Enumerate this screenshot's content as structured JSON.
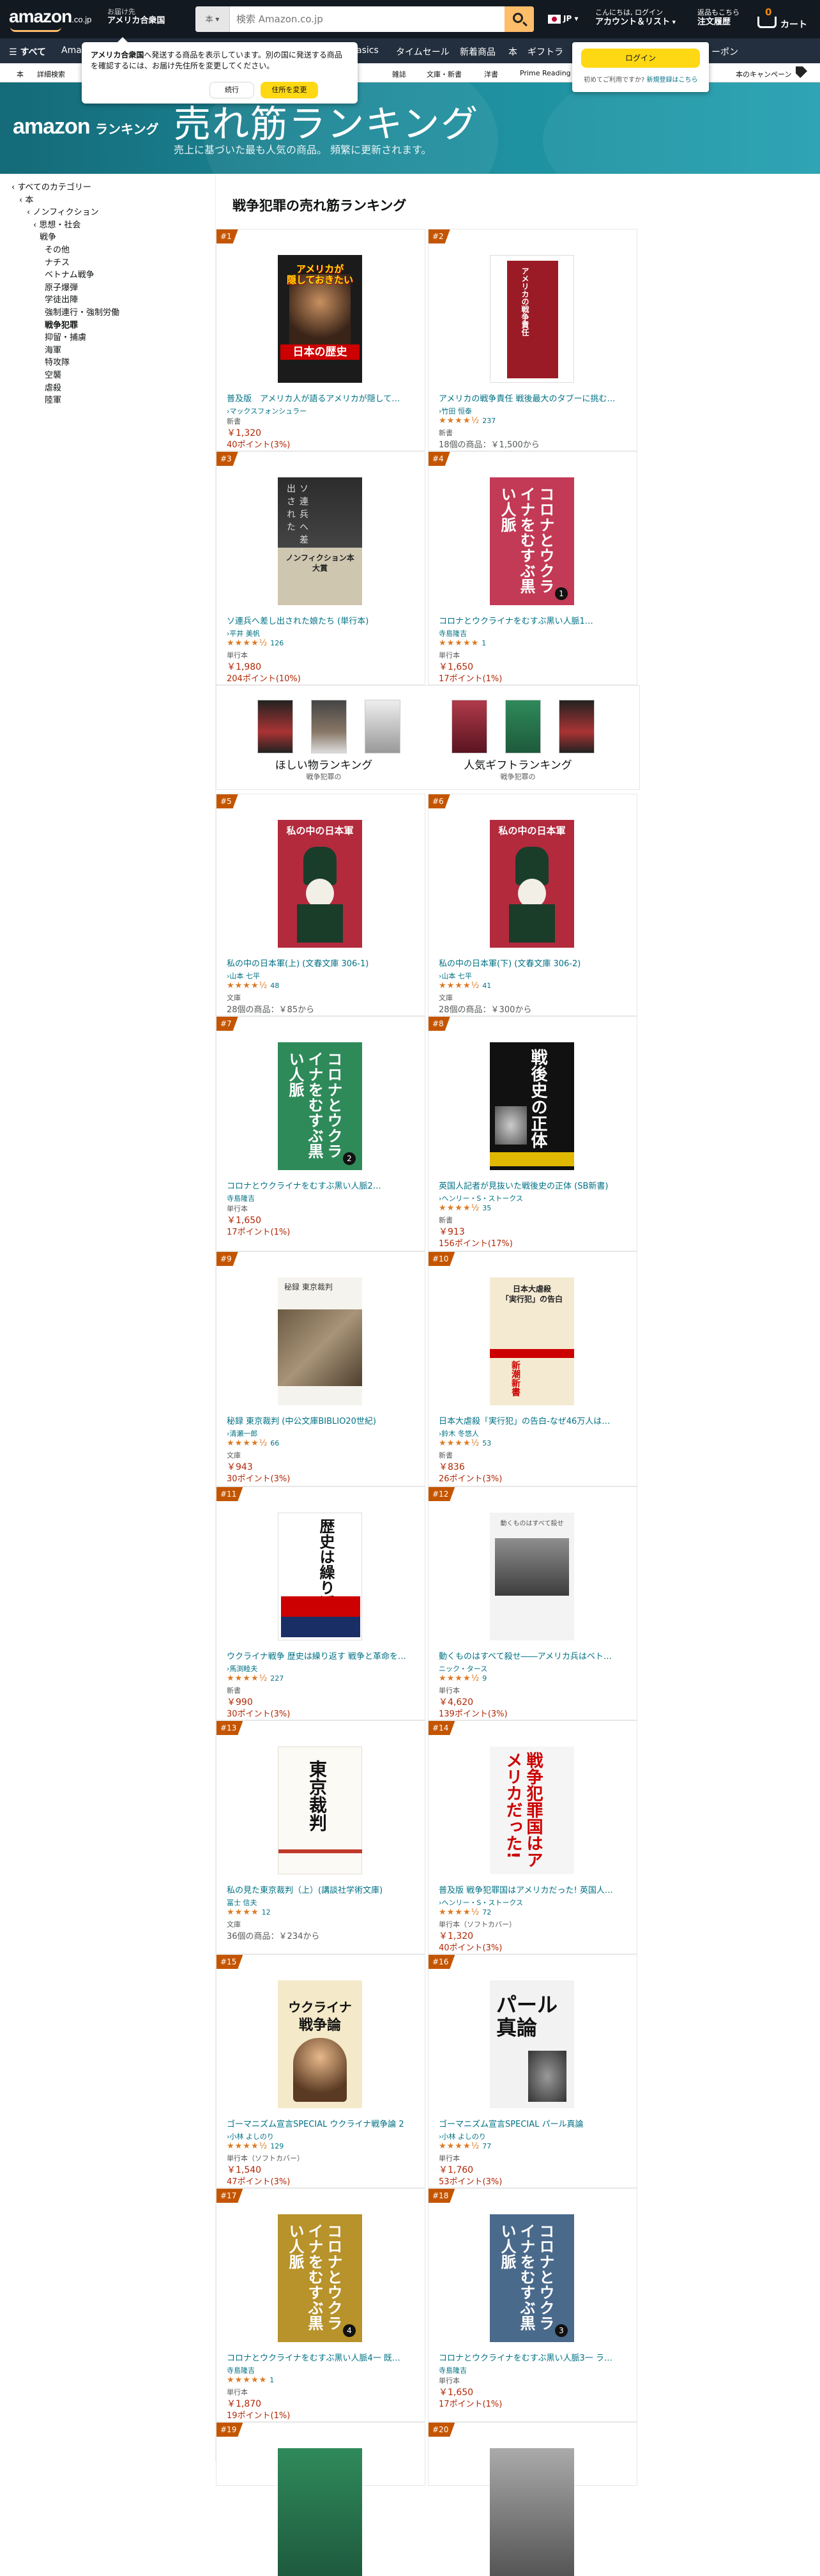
{
  "header": {
    "logo": "amazon",
    "logo_suffix": ".co.jp",
    "deliver_line1": "お届け先",
    "deliver_line2": "アメリカ合衆国",
    "search_category": "本",
    "search_placeholder": "検索 Amazon.co.jp",
    "lang": "JP",
    "account_line1": "こんにちは, ログイン",
    "account_line2": "アカウント＆リスト",
    "orders_line1": "返品もこちら",
    "orders_line2": "注文履歴",
    "cart_count": "0",
    "cart_label": "カート"
  },
  "nav": {
    "all": "すべて",
    "items": [
      "Amazon",
      "asics",
      "タイムセール",
      "新着商品",
      "本",
      "ギフトラ",
      "ーポン"
    ]
  },
  "subnav": {
    "items": [
      "本",
      "詳細検索",
      "雑誌",
      "文庫・新書",
      "洋書",
      "Prime Reading",
      "本のキャンペーン"
    ]
  },
  "popover": {
    "text_bold": "アメリカ合衆国",
    "text": "へ発送する商品を表示しています。別の国に発送する商品を確認するには、お届け先住所を変更してください。",
    "continue": "続行",
    "change": "住所を変更"
  },
  "login_popover": {
    "button": "ログイン",
    "text": "初めてご利用ですか?",
    "link": "新規登録はこちら"
  },
  "banner": {
    "logo": "amazon",
    "logo_suffix": "ランキング",
    "title": "売れ筋ランキング",
    "subtitle": "売上に基づいた最も人気の商品。 頻繁に更新されます。"
  },
  "sidebar": {
    "items": [
      {
        "label": "‹ すべてのカテゴリー",
        "level": 0
      },
      {
        "label": "‹ 本",
        "level": 1
      },
      {
        "label": "‹ ノンフィクション",
        "level": 2
      },
      {
        "label": "‹ 思想・社会",
        "level": 3
      },
      {
        "label": "戦争",
        "level": 4
      },
      {
        "label": "その他",
        "level": 5
      },
      {
        "label": "ナチス",
        "level": 5
      },
      {
        "label": "ベトナム戦争",
        "level": 5
      },
      {
        "label": "原子爆弾",
        "level": 5
      },
      {
        "label": "学徒出陣",
        "level": 5
      },
      {
        "label": "強制連行・強制労働",
        "level": 5
      },
      {
        "label": "戦争犯罪",
        "level": 5,
        "selected": true
      },
      {
        "label": "抑留・捕虜",
        "level": 5
      },
      {
        "label": "海軍",
        "level": 5
      },
      {
        "label": "特攻隊",
        "level": 5
      },
      {
        "label": "空襲",
        "level": 5
      },
      {
        "label": "虐殺",
        "level": 5
      },
      {
        "label": "陸軍",
        "level": 5
      }
    ]
  },
  "main": {
    "title": "戦争犯罪の売れ筋ランキング"
  },
  "promo": {
    "left_title": "ほしい物ランキング",
    "left_sub": "戦争犯罪の",
    "right_title": "人気ギフトランキング",
    "right_sub": "戦争犯罪の"
  },
  "products": [
    {
      "rank": "#1",
      "title": "普及版　アメリカ人が語るアメリカが隠して…",
      "author": "›マックスフォンシュラー",
      "stars": "",
      "reviews": "",
      "format": "新書",
      "price": "￥1,320",
      "points": "40ポイント(3%)",
      "offer": "",
      "cover": "c1",
      "cover_text": "日本の歴史"
    },
    {
      "rank": "#2",
      "title": "アメリカの戦争責任 戦後最大のタブーに挑む…",
      "author": "›竹田 恒泰",
      "stars": "★★★★½",
      "reviews": "237",
      "format": "新書",
      "price": "",
      "points": "",
      "offer": "18個の商品：￥1,500から",
      "cover": "c2",
      "cover_text": "アメリカの戦争責任"
    },
    {
      "rank": "#3",
      "title": "ソ連兵へ差し出された娘たち (単行本)",
      "author": "›平井 美帆",
      "stars": "★★★★½",
      "reviews": "126",
      "format": "単行本",
      "price": "￥1,980",
      "points": "204ポイント(10%)",
      "offer": "",
      "cover": "c3",
      "cover_text": "ノンフィクション本大賞"
    },
    {
      "rank": "#4",
      "title": "コロナとウクライナをむすぶ黒い人脈1…",
      "author": "寺島隆吉",
      "stars": "★★★★★",
      "reviews": "1",
      "format": "単行本",
      "price": "￥1,650",
      "points": "17ポイント(1%)",
      "offer": "",
      "cover": "c4",
      "cover_text": "コロナとウクライナをむすぶ黒い人脈"
    },
    {
      "rank": "#5",
      "title": "私の中の日本軍(上) (文春文庫 306-1)",
      "author": "›山本 七平",
      "stars": "★★★★½",
      "reviews": "48",
      "format": "文庫",
      "price": "",
      "points": "",
      "offer": "28個の商品：￥85から",
      "cover": "c5",
      "cover_text": "私の中の日本軍"
    },
    {
      "rank": "#6",
      "title": "私の中の日本軍(下) (文春文庫 306-2)",
      "author": "›山本 七平",
      "stars": "★★★★½",
      "reviews": "41",
      "format": "文庫",
      "price": "",
      "points": "",
      "offer": "28個の商品：￥300から",
      "cover": "c5",
      "cover_text": "私の中の日本軍"
    },
    {
      "rank": "#7",
      "title": "コロナとウクライナをむすぶ黒い人脈2…",
      "author": "寺島隆吉",
      "stars": "",
      "reviews": "",
      "format": "単行本",
      "price": "￥1,650",
      "points": "17ポイント(1%)",
      "offer": "",
      "cover": "c7",
      "cover_text": "コロナとウクライナをむすぶ黒い人脈"
    },
    {
      "rank": "#8",
      "title": "英国人記者が見抜いた戦後史の正体 (SB新書)",
      "author": "›ヘンリー・S・ストークス",
      "stars": "★★★★½",
      "reviews": "35",
      "format": "新書",
      "price": "￥913",
      "points": "156ポイント(17%)",
      "offer": "",
      "cover": "c8",
      "cover_text": "戦後史の正体"
    },
    {
      "rank": "#9",
      "title": "秘録 東京裁判 (中公文庫BIBLIO20世紀)",
      "author": "›清瀬一郎",
      "stars": "★★★★½",
      "reviews": "66",
      "format": "文庫",
      "price": "￥943",
      "points": "30ポイント(3%)",
      "offer": "",
      "cover": "c9",
      "cover_text": "秘録 東京裁判"
    },
    {
      "rank": "#10",
      "title": "日本大虐殺「実行犯」の告白-なぜ46万人は…",
      "author": "›鈴木 冬悠人",
      "stars": "★★★★½",
      "reviews": "53",
      "format": "新書",
      "price": "￥836",
      "points": "26ポイント(3%)",
      "offer": "",
      "cover": "c10",
      "cover_text": "日本大虐殺「実行犯」の告白"
    },
    {
      "rank": "#11",
      "title": "ウクライナ戦争 歴史は繰り返す 戦争と革命を…",
      "author": "›馬渕睦夫",
      "stars": "★★★★½",
      "reviews": "227",
      "format": "新書",
      "price": "￥990",
      "points": "30ポイント(3%)",
      "offer": "",
      "cover": "c11",
      "cover_text": "歴史は繰り返す"
    },
    {
      "rank": "#12",
      "title": "動くものはすべて殺せ――アメリカ兵はベト…",
      "author": "ニック・タース",
      "stars": "★★★★½",
      "reviews": "9",
      "format": "単行本",
      "price": "￥4,620",
      "points": "139ポイント(3%)",
      "offer": "",
      "cover": "c12",
      "cover_text": "動くものはすべて殺せ"
    },
    {
      "rank": "#13",
      "title": "私の見た東京裁判（上）(講談社学術文庫)",
      "author": "冨士 信夫",
      "stars": "★★★★",
      "reviews": "12",
      "format": "文庫",
      "price": "",
      "points": "",
      "offer": "36個の商品：￥234から",
      "cover": "c13",
      "cover_text": "私の見た東京裁判"
    },
    {
      "rank": "#14",
      "title": "普及版 戦争犯罪国はアメリカだった! 英国人…",
      "author": "›ヘンリー・S・ストークス",
      "stars": "★★★★½",
      "reviews": "72",
      "format": "単行本（ソフトカバー）",
      "price": "￥1,320",
      "points": "40ポイント(3%)",
      "offer": "",
      "cover": "c14",
      "cover_text": "戦争犯罪国はアメリカだった!"
    },
    {
      "rank": "#15",
      "title": "ゴーマニズム宣言SPECIAL ウクライナ戦争論 2",
      "author": "›小林 よしのり",
      "stars": "★★★★½",
      "reviews": "129",
      "format": "単行本（ソフトカバー）",
      "price": "￥1,540",
      "points": "47ポイント(3%)",
      "offer": "",
      "cover": "c15",
      "cover_text": "ウクライナ戦争論"
    },
    {
      "rank": "#16",
      "title": "ゴーマニズム宣言SPECIAL パール真論",
      "author": "›小林 よしのり",
      "stars": "★★★★½",
      "reviews": "77",
      "format": "単行本",
      "price": "￥1,760",
      "points": "53ポイント(3%)",
      "offer": "",
      "cover": "c16",
      "cover_text": "パール真論"
    },
    {
      "rank": "#17",
      "title": "コロナとウクライナをむすぶ黒い人脈4一 既…",
      "author": "寺島隆吉",
      "stars": "★★★★★",
      "reviews": "1",
      "format": "単行本",
      "price": "￥1,870",
      "points": "19ポイント(1%)",
      "offer": "",
      "cover": "c17",
      "cover_text": "コロナとウクライナをむすぶ黒い人脈"
    },
    {
      "rank": "#18",
      "title": "コロナとウクライナをむすぶ黒い人脈3一 ラ…",
      "author": "寺島隆吉",
      "stars": "",
      "reviews": "",
      "format": "単行本",
      "price": "￥1,650",
      "points": "17ポイント(1%)",
      "offer": "",
      "cover": "c18",
      "cover_text": "コロナとウクライナをむすぶ黒い人脈"
    },
    {
      "rank": "#19",
      "title": "",
      "author": "",
      "stars": "",
      "reviews": "",
      "format": "",
      "price": "",
      "points": "",
      "offer": "",
      "cover": "c19",
      "cover_text": ""
    },
    {
      "rank": "#20",
      "title": "",
      "author": "",
      "stars": "",
      "reviews": "",
      "format": "",
      "price": "",
      "points": "",
      "offer": "",
      "cover": "c20",
      "cover_text": ""
    }
  ]
}
